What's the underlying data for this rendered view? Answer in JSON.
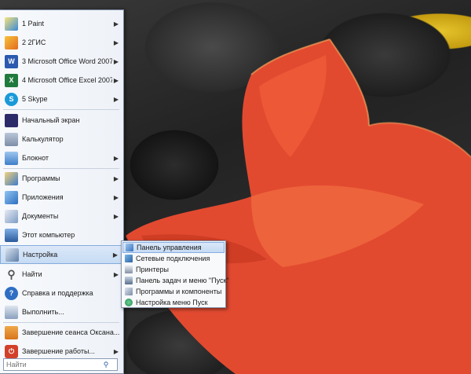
{
  "start_menu": {
    "pinned": [
      {
        "label": "1 Paint",
        "icon": "paint-icon",
        "has_arrow": true
      },
      {
        "label": "2 2ГИС",
        "icon": "2gis-icon",
        "has_arrow": true
      },
      {
        "label": "3 Microsoft Office Word 2007",
        "icon": "word-icon",
        "has_arrow": true
      },
      {
        "label": "4 Microsoft Office Excel 2007",
        "icon": "excel-icon",
        "has_arrow": true
      },
      {
        "label": "5 Skype",
        "icon": "skype-icon",
        "has_arrow": true
      },
      {
        "label": "Начальный экран",
        "icon": "start-screen-icon",
        "has_arrow": false
      },
      {
        "label": "Калькулятор",
        "icon": "calculator-icon",
        "has_arrow": false
      },
      {
        "label": "Блокнот",
        "icon": "notepad-icon",
        "has_arrow": true
      }
    ],
    "main": [
      {
        "label": "Программы",
        "icon": "programs-icon",
        "has_arrow": true
      },
      {
        "label": "Приложения",
        "icon": "apps-icon",
        "has_arrow": true
      },
      {
        "label": "Документы",
        "icon": "documents-icon",
        "has_arrow": true
      },
      {
        "label": "Этот компьютер",
        "icon": "computer-icon",
        "has_arrow": false
      },
      {
        "label": "Настройка",
        "icon": "settings-icon",
        "has_arrow": true,
        "highlighted": true
      },
      {
        "label": "Найти",
        "icon": "search-magnifier-icon",
        "has_arrow": true
      },
      {
        "label": "Справка и поддержка",
        "icon": "help-icon",
        "has_arrow": false
      },
      {
        "label": "Выполнить...",
        "icon": "run-icon",
        "has_arrow": false
      }
    ],
    "session": [
      {
        "label": "Завершение сеанса Оксана...",
        "icon": "logoff-icon",
        "has_arrow": false
      },
      {
        "label": "Завершение работы...",
        "icon": "shutdown-icon",
        "has_arrow": true
      }
    ],
    "search": {
      "placeholder": "Найти"
    }
  },
  "submenu": {
    "items": [
      {
        "label": "Панель управления",
        "icon": "control-panel-icon",
        "highlighted": true
      },
      {
        "label": "Сетевые подключения",
        "icon": "network-icon"
      },
      {
        "label": "Принтеры",
        "icon": "printer-icon"
      },
      {
        "label": "Панель задач и меню \"Пуск\"",
        "icon": "taskbar-icon"
      },
      {
        "label": "Программы и компоненты",
        "icon": "programs-features-icon"
      },
      {
        "label": "Настройка меню Пуск",
        "icon": "start-menu-settings-icon"
      }
    ]
  },
  "colors": {
    "highlight": "#c6dbf4",
    "menu_bg": "#f2f5fa",
    "flower": "#e8452c"
  }
}
